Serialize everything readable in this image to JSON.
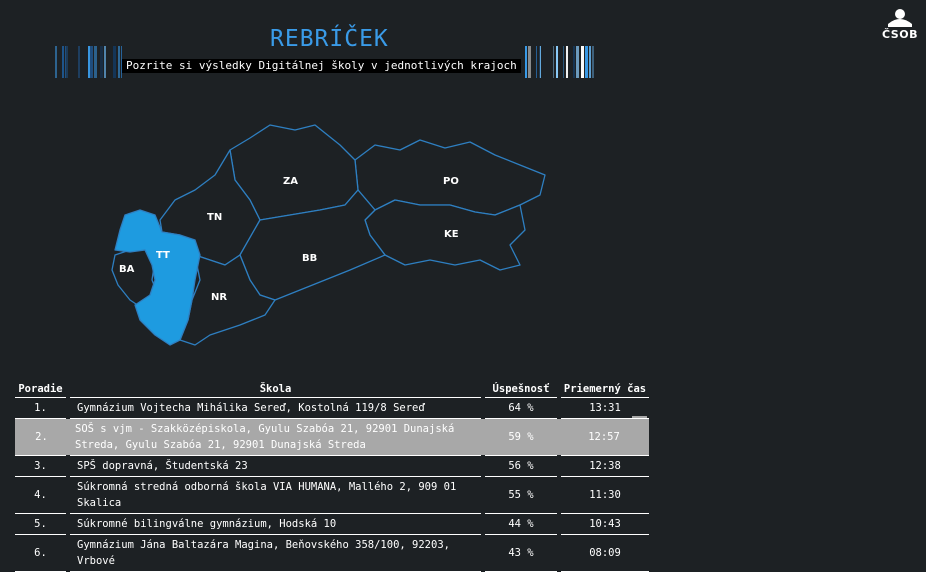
{
  "brand": {
    "name": "ČSOB"
  },
  "header": {
    "title": "REBRÍČEK",
    "subtitle": "Pozrite si výsledky Digitálnej školy v jednotlivých krajoch"
  },
  "map": {
    "selected_region": "TT",
    "colors": {
      "outline": "#2e7fc1",
      "selected": "#1e9be0",
      "background": "#1d2124"
    },
    "regions": [
      {
        "code": "BA"
      },
      {
        "code": "TT"
      },
      {
        "code": "TN"
      },
      {
        "code": "NR"
      },
      {
        "code": "ZA"
      },
      {
        "code": "BB"
      },
      {
        "code": "PO"
      },
      {
        "code": "KE"
      }
    ]
  },
  "table": {
    "headers": [
      "Poradie",
      "Škola",
      "Úspešnosť",
      "Priemerný čas"
    ],
    "rows": [
      {
        "rank": "1.",
        "school": "Gymnázium Vojtecha Mihálika Sereď, Kostolná 119/8 Sereď",
        "success": "64 %",
        "time": "13:31"
      },
      {
        "rank": "2.",
        "school": "SOŠ s vjm - Szakközépiskola, Gyulu Szabóa 21, 92901 Dunajská Streda, Gyulu Szabóa 21, 92901 Dunajská Streda",
        "success": "59 %",
        "time": "12:57"
      },
      {
        "rank": "3.",
        "school": "SPŠ dopravná, Študentská 23",
        "success": "56 %",
        "time": "12:38"
      },
      {
        "rank": "4.",
        "school": "Súkromná stredná odborná škola VIA HUMANA, Mallého 2, 909 01 Skalica",
        "success": "55 %",
        "time": "11:30"
      },
      {
        "rank": "5.",
        "school": "Súkromné bilingválne gymnázium, Hodská 10",
        "success": "44 %",
        "time": "10:43"
      },
      {
        "rank": "6.",
        "school": "Gymnázium Jána Baltazára Magina, Beňovského 358/100, 92203, Vrbové",
        "success": "43 %",
        "time": "08:09"
      }
    ]
  }
}
